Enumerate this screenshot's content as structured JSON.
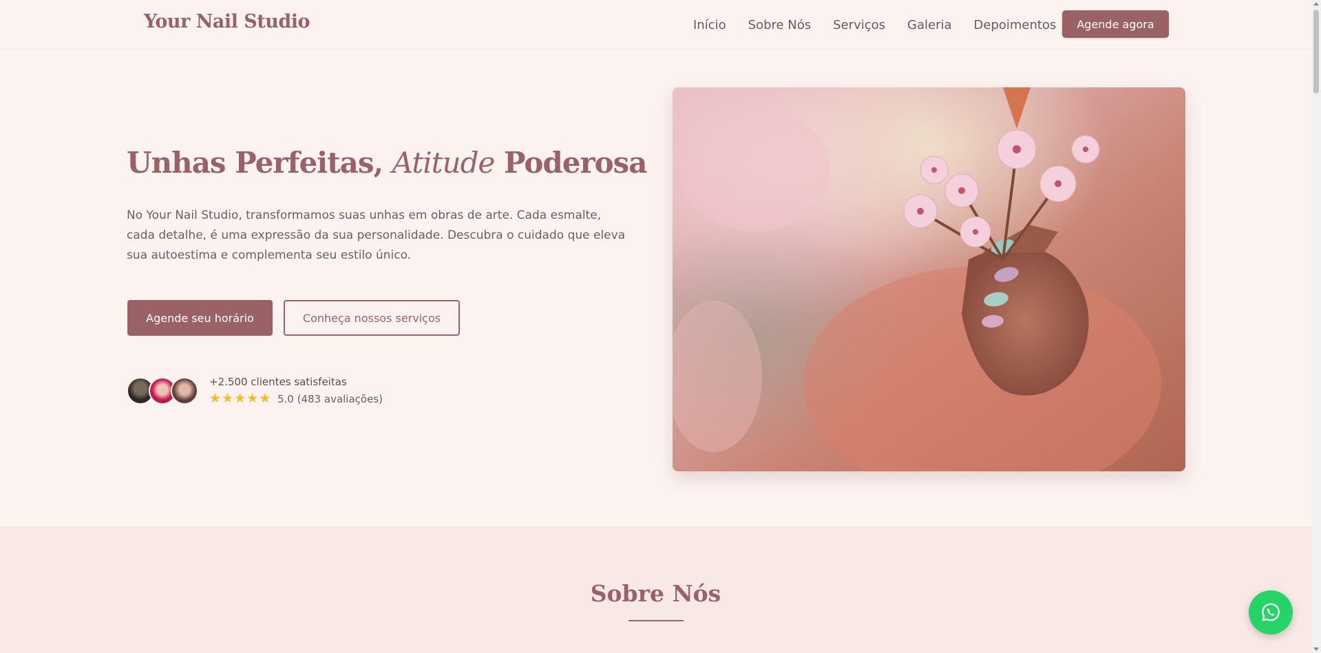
{
  "header": {
    "logo": "Your Nail Studio",
    "nav": [
      "Início",
      "Sobre Nós",
      "Serviços",
      "Galeria",
      "Depoimentos"
    ],
    "cta": "Agende agora"
  },
  "hero": {
    "title_part1": "Unhas Perfeitas, ",
    "title_accent": "Atitude",
    "title_part2": " Poderosa",
    "description": "No Your Nail Studio, transformamos suas unhas em obras de arte. Cada esmalte, cada detalhe, é uma expressão da sua personalidade. Descubra o cuidado que eleva sua autoestima e complementa seu estilo único.",
    "primary_button": "Agende seu horário",
    "secondary_button": "Conheça nossos serviços",
    "social_proof": {
      "clients": "+2.500 clientes satisfeitas",
      "rating_text": "5.0 (483 avaliações)",
      "stars": 5
    }
  },
  "about": {
    "title": "Sobre Nós"
  },
  "icons": {
    "whatsapp": "whatsapp-icon",
    "star": "star-icon"
  },
  "colors": {
    "brand": "#9a6264",
    "background": "#fcf3f1",
    "section_bg": "#f9e9e6",
    "star": "#f5bd1f",
    "whatsapp": "#25d366"
  }
}
